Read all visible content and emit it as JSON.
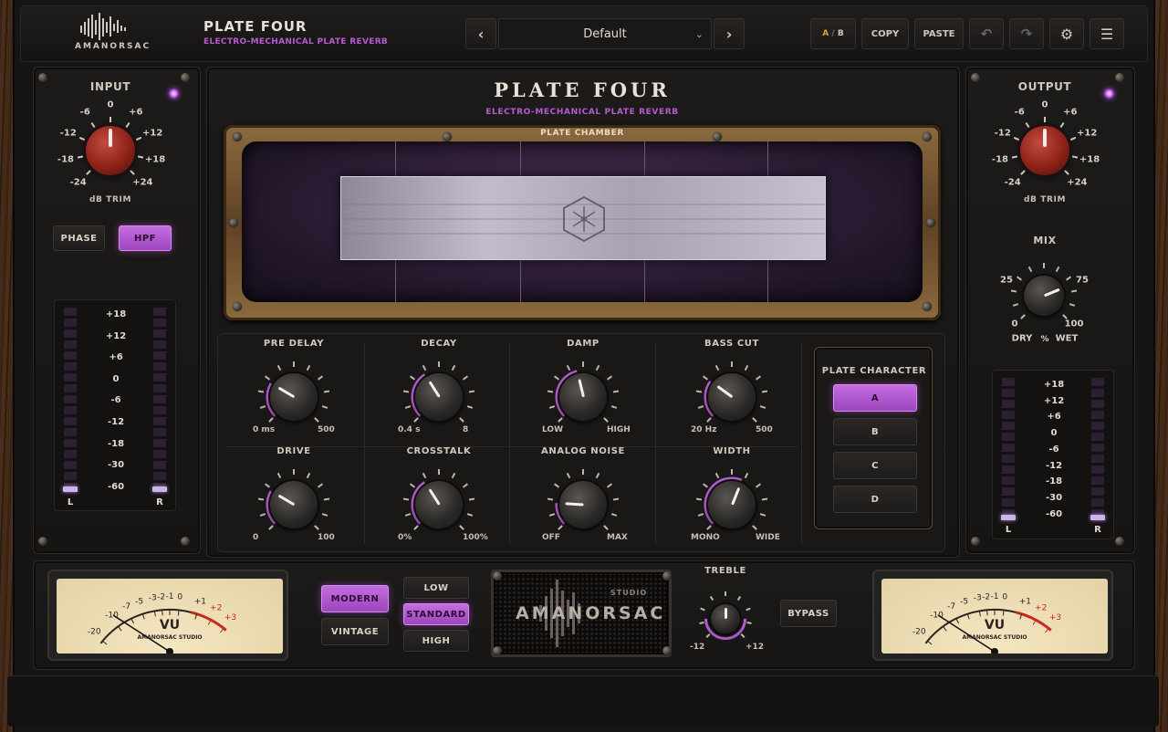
{
  "header": {
    "brand": "AMANORSAC",
    "product_title": "PLATE FOUR",
    "product_subtitle": "ELECTRO-MECHANICAL PLATE REVERB",
    "preset_name": "Default",
    "ab_a": "A",
    "ab_sep": "/",
    "ab_b": "B",
    "copy_label": "COPY",
    "paste_label": "PASTE"
  },
  "input": {
    "title": "INPUT",
    "unit": "dB TRIM",
    "scale": [
      "-24",
      "-18",
      "-12",
      "-6",
      "0",
      "+6",
      "+12",
      "+18",
      "+24"
    ],
    "value_db": 0,
    "phase_label": "PHASE",
    "hpf_label": "HPF",
    "meter_scale": [
      "+18",
      "+12",
      "+6",
      "0",
      "-6",
      "-12",
      "-18",
      "-30",
      "-60"
    ],
    "meter_left": "L",
    "meter_right": "R"
  },
  "output": {
    "title": "OUTPUT",
    "unit": "dB TRIM",
    "scale": [
      "-24",
      "-18",
      "-12",
      "-6",
      "0",
      "+6",
      "+12",
      "+18",
      "+24"
    ],
    "value_db": 0,
    "mix_title": "MIX",
    "mix_labels": {
      "min": "0",
      "q1": "25",
      "q3": "75",
      "max": "100",
      "unit": "%",
      "dry": "DRY",
      "wet": "WET"
    },
    "mix_value": 75,
    "meter_scale": [
      "+18",
      "+12",
      "+6",
      "0",
      "-6",
      "-12",
      "-18",
      "-30",
      "-60"
    ],
    "meter_left": "L",
    "meter_right": "R"
  },
  "center": {
    "title": "PLATE FOUR",
    "subtitle": "ELECTRO-MECHANICAL PLATE REVERB",
    "chamber_label": "PLATE CHAMBER"
  },
  "knobs": {
    "pre_delay": {
      "label": "PRE DELAY",
      "min": "0 ms",
      "max": "500",
      "value": 0.28
    },
    "decay": {
      "label": "DECAY",
      "min": "0.4 s",
      "max": "8",
      "value": 0.38
    },
    "damp": {
      "label": "DAMP",
      "min": "LOW",
      "max": "HIGH",
      "value": 0.45
    },
    "bass_cut": {
      "label": "BASS CUT",
      "min": "20 Hz",
      "max": "500",
      "value": 0.3
    },
    "drive": {
      "label": "DRIVE",
      "min": "0",
      "max": "100",
      "value": 0.28
    },
    "crosstalk": {
      "label": "CROSSTALK",
      "min": "0%",
      "max": "100%",
      "value": 0.38
    },
    "analog_noise": {
      "label": "ANALOG NOISE",
      "min": "OFF",
      "max": "MAX",
      "value": 0.18
    },
    "width": {
      "label": "WIDTH",
      "min": "MONO",
      "max": "WIDE",
      "value": 0.58
    }
  },
  "plate_character": {
    "title": "PLATE CHARACTER",
    "options": [
      "A",
      "B",
      "C",
      "D"
    ],
    "selected": "A"
  },
  "bottom": {
    "vu_label": "VU",
    "vu_brand": "AMANORSAC STUDIO",
    "vu_scale": [
      "-20",
      "-10",
      "-7",
      "-5",
      "-3",
      "-2",
      "-1",
      "0",
      "+1",
      "+2",
      "+3"
    ],
    "modern_label": "MODERN",
    "vintage_label": "VINTAGE",
    "low_label": "LOW",
    "standard_label": "STANDARD",
    "high_label": "HIGH",
    "grill_brand": "AMANORSAC",
    "grill_studio": "STUDIO",
    "treble_label": "TREBLE",
    "treble_min": "-12",
    "treble_max": "+12",
    "treble_value": 0.5,
    "bypass_label": "BYPASS"
  },
  "colors": {
    "accent": "#b45bd0",
    "knob_red": "#a8342a",
    "wood": "#3a2315"
  }
}
